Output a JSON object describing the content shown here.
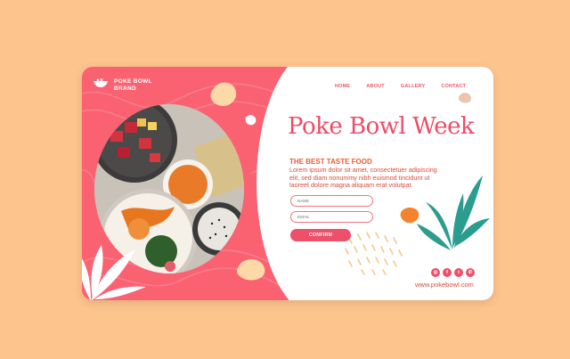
{
  "brand": {
    "line1": "POKE BOWL",
    "line2": "BRAND"
  },
  "nav": [
    {
      "label": "HOME"
    },
    {
      "label": "ABOUT"
    },
    {
      "label": "GALLERY"
    },
    {
      "label": "CONTACT"
    }
  ],
  "hero": {
    "title": "Poke Bowl Week",
    "subtitle": "THE BEST TASTE FOOD",
    "body": "Lorem ipsum dolor sit amet, consectetuer adipiscing elit, sed diam nonummy nibh euismod tincidunt ut laoreet dolore magna aliquam erat volutpat."
  },
  "form": {
    "name_placeholder": "NAME",
    "email_placeholder": "EMAIL",
    "confirm_label": "CONFIRM"
  },
  "social": {
    "icons": [
      "instagram-icon",
      "facebook-icon",
      "twitter-icon",
      "whatsapp-icon"
    ],
    "glyphs": [
      "◎",
      "f",
      "t",
      "✆"
    ]
  },
  "footer": {
    "url": "www.pokebowl.com"
  },
  "colors": {
    "background": "#fdc48e",
    "primary": "#fa6272",
    "accent": "#ee4f69",
    "orange": "#f5832e",
    "teal": "#2a9d8f"
  }
}
